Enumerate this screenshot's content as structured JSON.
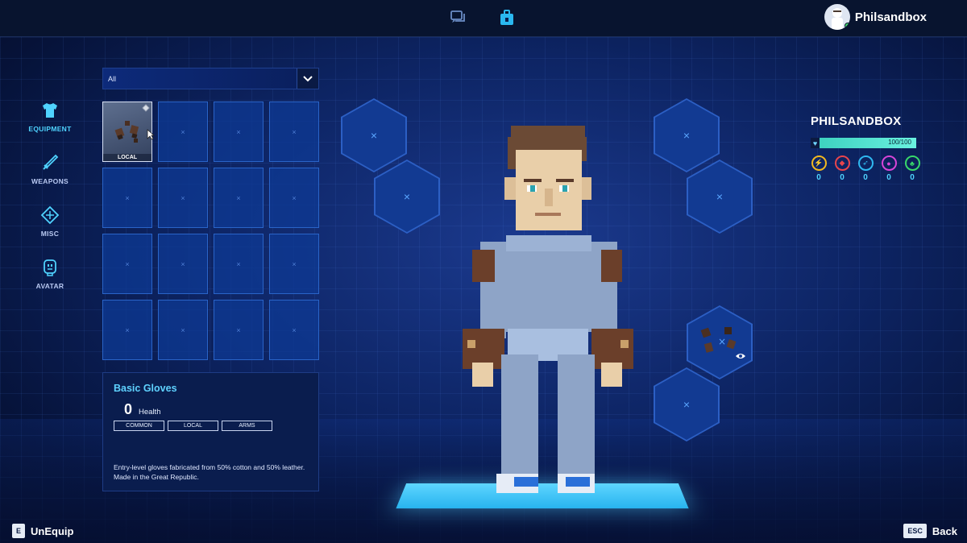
{
  "top_bar": {
    "icons": [
      "chat-icon",
      "inventory-icon"
    ],
    "user_name": "Philsandbox"
  },
  "nav": {
    "items": [
      {
        "label": "EQUIPMENT",
        "icon": "shirt-icon",
        "active": true
      },
      {
        "label": "WEAPONS",
        "icon": "sword-icon",
        "active": false
      },
      {
        "label": "MISC",
        "icon": "diamond-icon",
        "active": false
      },
      {
        "label": "AVATAR",
        "icon": "face-icon",
        "active": false
      }
    ]
  },
  "filter": {
    "value": "All"
  },
  "inventory": {
    "filled_slot": {
      "tag": "LOCAL",
      "item": "gloves-icon"
    },
    "empty_marker": "×"
  },
  "detail": {
    "title": "Basic Gloves",
    "stat_value": "0",
    "stat_label": "Health",
    "tags": [
      "COMMON",
      "LOCAL",
      "ARMS"
    ],
    "description": "Entry-level gloves fabricated from 50% cotton and 50% leather. Made in the Great Republic."
  },
  "equip_slots": {
    "empty_marker": "×"
  },
  "player": {
    "name": "PHILSANDBOX",
    "hp_text": "100/100",
    "hp_fraction": 1.0,
    "stats": [
      {
        "icon": "lightning-icon",
        "color": "#f2b81f",
        "value": "0"
      },
      {
        "icon": "shield-icon",
        "color": "#e8454c",
        "value": "0"
      },
      {
        "icon": "feather-icon",
        "color": "#2fb8f0",
        "value": "0"
      },
      {
        "icon": "brain-icon",
        "color": "#d845d8",
        "value": "0"
      },
      {
        "icon": "clover-icon",
        "color": "#38d86a",
        "value": "0"
      }
    ]
  },
  "prompts": {
    "unequip_key": "E",
    "unequip_label": "UnEquip",
    "back_key": "ESC",
    "back_label": "Back"
  },
  "colors": {
    "accent": "#4fd3ff",
    "hp": "#3ed2c0",
    "slot": "#0e3a94"
  }
}
